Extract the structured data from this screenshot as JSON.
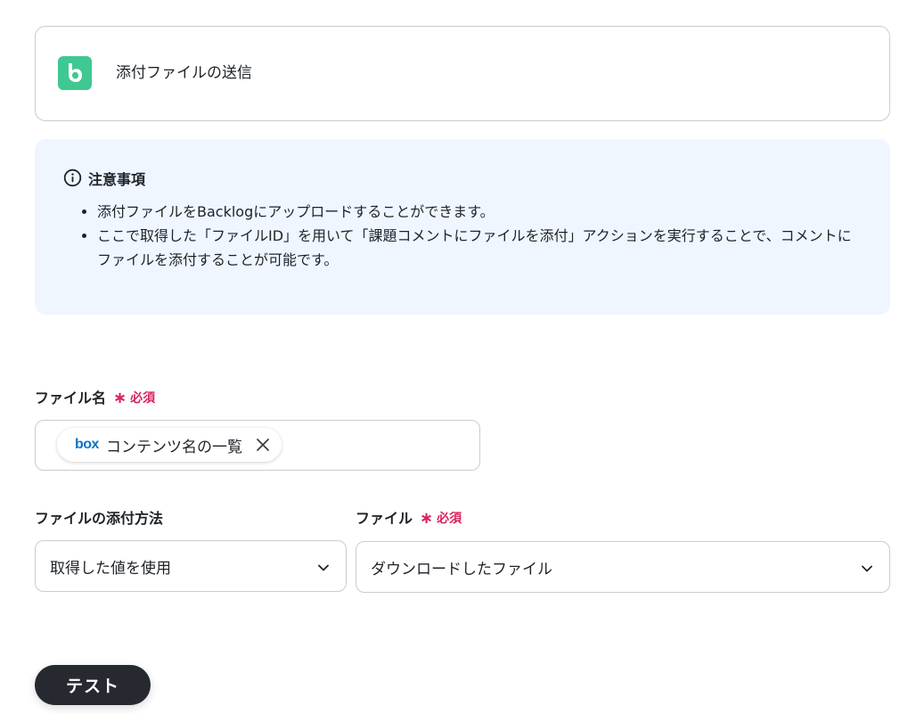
{
  "action": {
    "title": "添付ファイルの送信",
    "logo_letter": "b"
  },
  "notice": {
    "title": "注意事項",
    "items": [
      "添付ファイルをBacklogにアップロードすることができます。",
      "ここで取得した「ファイルID」を用いて「課題コメントにファイルを添付」アクションを実行することで、コメントにファイルを添付することが可能です。"
    ]
  },
  "filename_field": {
    "label": "ファイル名",
    "required_mark": "∗",
    "required_text": "必須",
    "chip": {
      "source": "box",
      "label": "コンテンツ名の一覧"
    }
  },
  "attach_method_field": {
    "label": "ファイルの添付方法",
    "value": "取得した値を使用"
  },
  "file_field": {
    "label": "ファイル",
    "required_mark": "∗",
    "required_text": "必須",
    "value": "ダウンロードしたファイル"
  },
  "test_button": {
    "label": "テスト"
  },
  "colors": {
    "accent_green": "#3fc892",
    "required_red": "#d6245b",
    "notice_bg": "#eff6ff",
    "box_blue": "#0c72c7",
    "button_dark": "#262a30"
  }
}
